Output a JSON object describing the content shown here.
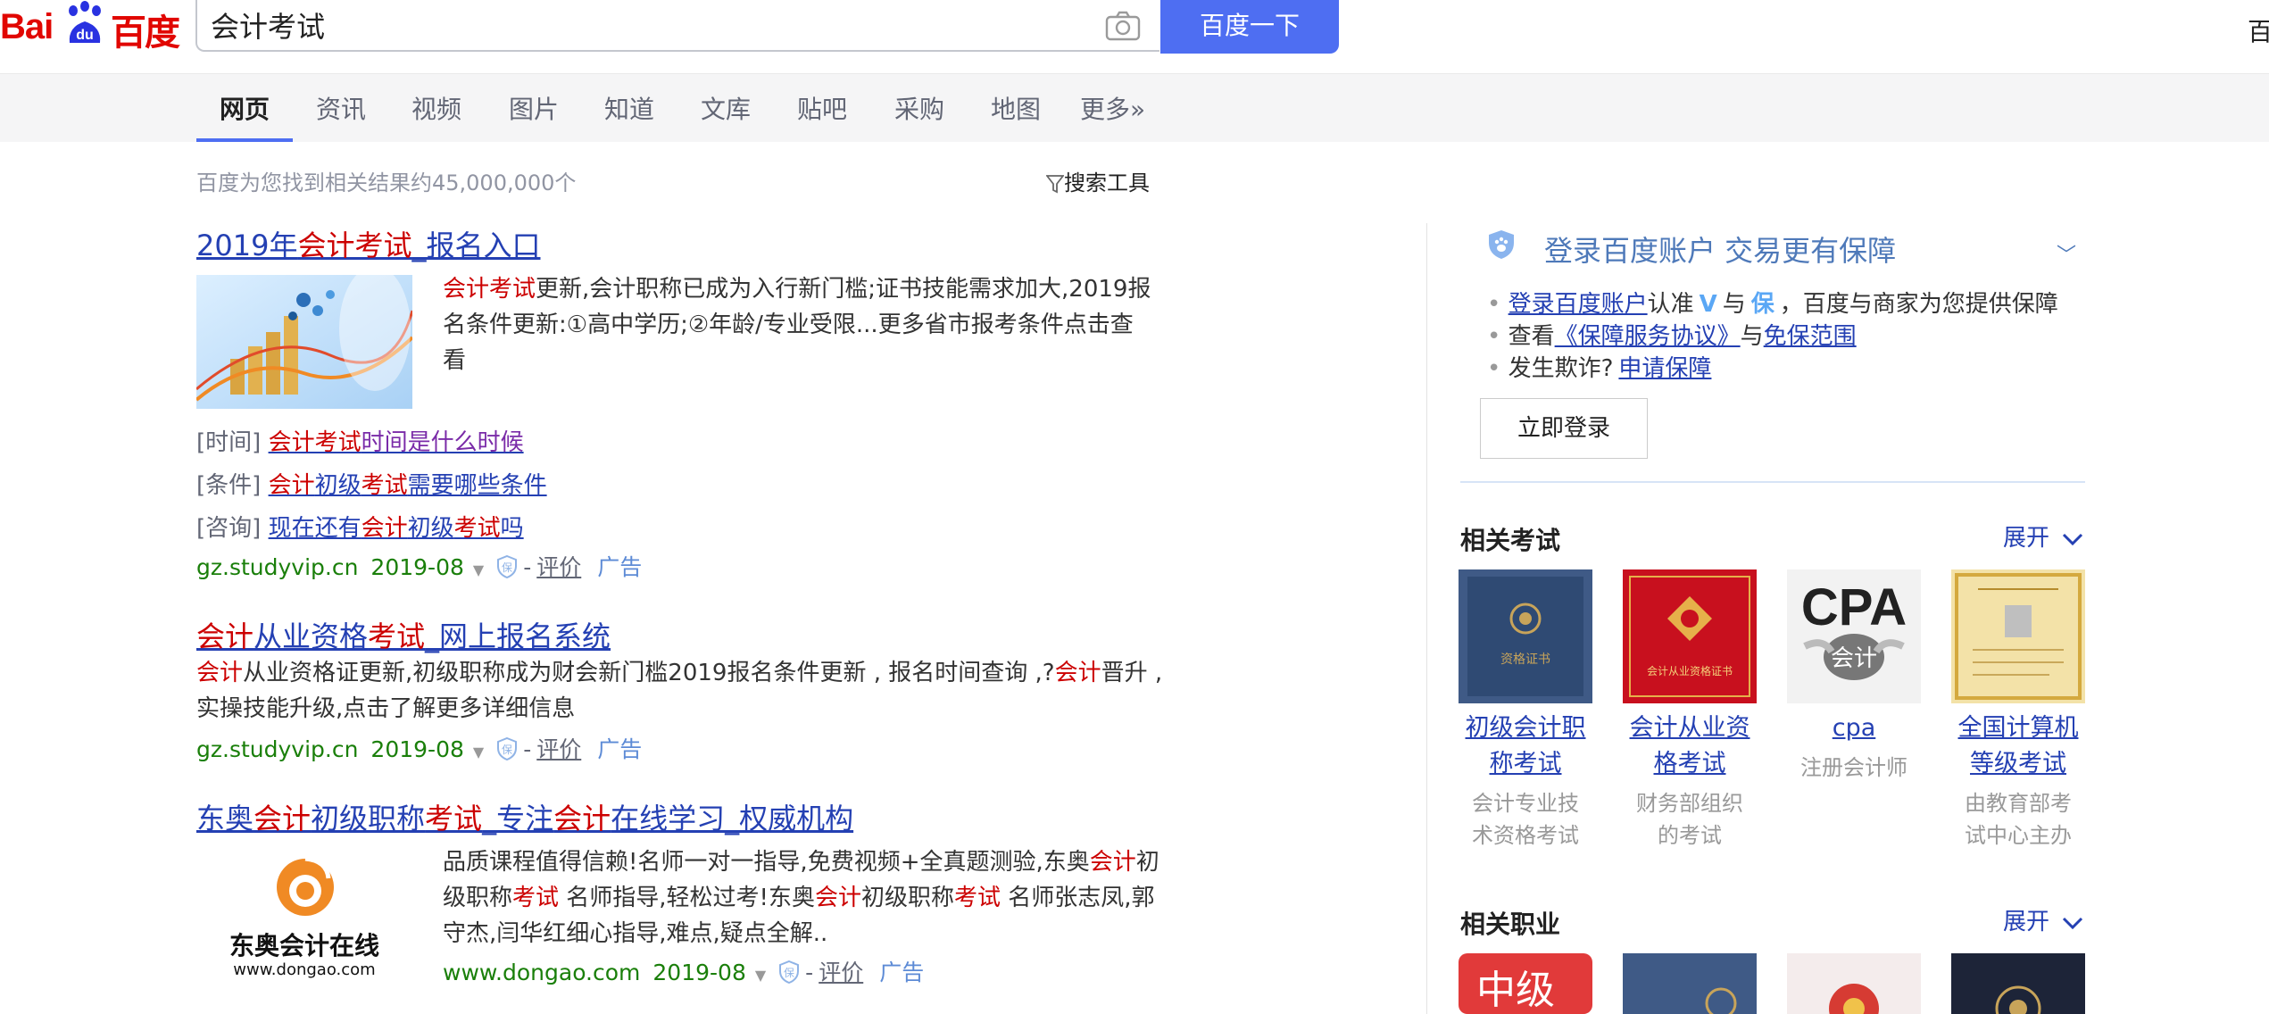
{
  "header": {
    "logo_text_latin": "Bai",
    "logo_text_du": "du",
    "logo_text_cn": "百度",
    "search_value": "会计考试",
    "search_button": "百度一下",
    "right_link": "百"
  },
  "tabs": [
    {
      "label": "网页",
      "active": true
    },
    {
      "label": "资讯"
    },
    {
      "label": "视频"
    },
    {
      "label": "图片"
    },
    {
      "label": "知道"
    },
    {
      "label": "文库"
    },
    {
      "label": "贴吧"
    },
    {
      "label": "采购"
    },
    {
      "label": "地图"
    },
    {
      "label": "更多»"
    }
  ],
  "result_count": "百度为您找到相关结果约45,000,000个",
  "search_tools": "搜索工具",
  "results": [
    {
      "title_parts": [
        "2019年",
        "会计考试",
        "_报名入口"
      ],
      "snippet_hl": "会计考试",
      "snippet_lines": [
        "更新,会计职称已成为入行新门槛;证书技能需求加大,2019报",
        "名条件更新:①高中学历;②年龄/专业受限...更多省市报考条件点击查",
        "看"
      ],
      "sublinks": [
        {
          "label": "[时间]",
          "parts": [
            "会计考试",
            "时间是什么时候"
          ]
        },
        {
          "label": "[条件]",
          "parts": [
            "会计",
            "初级",
            "考试",
            "需要哪些条件"
          ]
        },
        {
          "label": "[咨询]",
          "parts": [
            "现在还有",
            "会计",
            "初级",
            "考试",
            "吗"
          ]
        }
      ],
      "url": "gz.studyvip.cn",
      "date": "2019-08",
      "pingjia": "评价",
      "ad": "广告",
      "dash": "-"
    },
    {
      "title_parts": [
        "会计",
        "从业资格",
        "考试",
        "_网上报名系统"
      ],
      "snippet_parts": [
        "会计",
        "从业资格证更新,初级职称成为财会新门槛2019报名条件更新 , 报名时间查询 ,?",
        "会计",
        "晋升 ,"
      ],
      "snippet_line2": "实操技能升级,点击了解更多详细信息",
      "url": "gz.studyvip.cn",
      "date": "2019-08",
      "pingjia": "评价",
      "ad": "广告",
      "dash": "-"
    },
    {
      "title_parts": [
        "东奥",
        "会计",
        "初级职称",
        "考试",
        "_专注",
        "会计",
        "在线学习_权威机构"
      ],
      "snippet_l1": [
        "品质课程值得信赖!名师一对一指导,免费视频+全真题测验,东奥",
        "会计",
        "初"
      ],
      "snippet_l2": [
        "级职称",
        "考试",
        " 名师指导,轻松过考!东奥",
        "会计",
        "初级职称",
        "考试",
        " 名师张志凤,郭"
      ],
      "snippet_l3": "守杰,闫华红细心指导,难点,疑点全解..",
      "logo_name": "东奥会计在线",
      "logo_url": "www.dongao.com",
      "url": "www.dongao.com",
      "date": "2019-08",
      "pingjia": "评价",
      "ad": "广告",
      "dash": "-"
    }
  ],
  "bao": {
    "title": "登录百度账户  交易更有保障",
    "line1": {
      "link": "登录百度账户",
      "t1": "认准",
      "v": "V",
      "t2": "与",
      "b": "保",
      "t3": "，百度与商家为您提供保障"
    },
    "line2": {
      "t1": "查看",
      "link1": "《保障服务协议》",
      "t2": "与",
      "link2": "免保范围"
    },
    "line3": {
      "t1": "发生欺诈?",
      "link": "申请保障"
    },
    "login_button": "立即登录"
  },
  "related_exams": {
    "title": "相关考试",
    "expand": "展开",
    "cards": [
      {
        "name_l1": "初级会计职",
        "name_l2": "称考试",
        "desc_l1": "会计专业技",
        "desc_l2": "术资格考试",
        "img_text": "资格证书"
      },
      {
        "name_l1": "会计从业资",
        "name_l2": "格考试",
        "desc_l1": "财务部组织",
        "desc_l2": "的考试",
        "img_text": "会计从业资格证书"
      },
      {
        "name_l1": "cpa",
        "name_l2": "",
        "desc_l1": "注册会计师",
        "desc_l2": "",
        "img_text": "CPA",
        "img_text2": "会计"
      },
      {
        "name_l1": "全国计算机",
        "name_l2": "等级考试",
        "desc_l1": "由教育部考",
        "desc_l2": "试中心主办",
        "img_text": ""
      }
    ]
  },
  "related_jobs": {
    "title": "相关职业",
    "expand": "展开",
    "first_img_text": "中级"
  },
  "colors": {
    "brand_blue": "#4e6ef2",
    "link": "#2440b3",
    "highlight": "#cc0000",
    "url_green": "#1a7f0a",
    "logo_red": "#e10601"
  }
}
